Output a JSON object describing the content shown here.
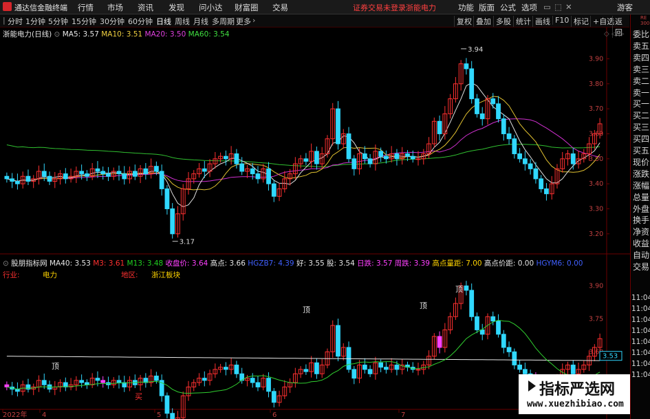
{
  "app": {
    "title": "通达信金融终端"
  },
  "menu": [
    "行情",
    "市场",
    "资讯",
    "发现",
    "问小达",
    "财富圈",
    "交易"
  ],
  "status": {
    "warning": "证券交易未登录",
    "stock_name": "浙能电力"
  },
  "right_menu": [
    "功能",
    "版面",
    "公式",
    "选项"
  ],
  "guest": "游客",
  "periods": [
    "分时",
    "1分钟",
    "5分钟",
    "15分钟",
    "30分钟",
    "60分钟",
    "日线",
    "周线",
    "月线",
    "多周期",
    "更多"
  ],
  "active_period": "日线",
  "toolbar": [
    "复权",
    "叠加",
    "多股",
    "统计",
    "画线",
    "F10",
    "标记",
    "+自选",
    "返回"
  ],
  "side_panel": {
    "top_small": "RE\n300",
    "items": [
      "委比",
      "卖五",
      "卖四",
      "卖三",
      "卖二",
      "卖一",
      "买一",
      "买二",
      "买三",
      "买四",
      "买五",
      "现价",
      "涨跌",
      "涨幅",
      "总量",
      "外盘",
      "换手",
      "净资",
      "收益",
      "自动",
      "交易"
    ],
    "times": [
      "11:04",
      "11:04",
      "11:04",
      "11:04",
      "11:04",
      "11:04",
      "11:04",
      "11:04"
    ]
  },
  "main_chart": {
    "title": "浙能电力(日线)",
    "ma5": "MA5: 3.57",
    "ma10": "MA10: 3.51",
    "ma20": "MA20: 3.50",
    "ma60": "MA60: 3.54",
    "high_label": "3.94",
    "low_label": "3.17",
    "yticks": [
      "3.90",
      "3.80",
      "3.70",
      "3.60",
      "3.50",
      "3.40",
      "3.30",
      "3.20"
    ],
    "ylim": [
      3.15,
      3.97
    ]
  },
  "sub_chart": {
    "title": "股朋指标网",
    "items": [
      {
        "t": "MA40: 3.53",
        "c": "wht"
      },
      {
        "t": "M3: 3.61",
        "c": "red"
      },
      {
        "t": "M13: 3.48",
        "c": "green"
      },
      {
        "t": "收盘价: 3.64",
        "c": "mag"
      },
      {
        "t": "高点: 3.66",
        "c": "wht"
      },
      {
        "t": "HGZB7: 4.39",
        "c": "blue"
      },
      {
        "t": "好: 3.55",
        "c": "wht"
      },
      {
        "t": "股: 3.54",
        "c": "wht"
      },
      {
        "t": "日跌: 3.57",
        "c": "mag"
      },
      {
        "t": "周跌: 3.39",
        "c": "mag"
      },
      {
        "t": "高点量距: 7.00",
        "c": "yel"
      },
      {
        "t": "高点价距: 0.00",
        "c": "wht"
      },
      {
        "t": "HGYM6: 0.00",
        "c": "blue"
      }
    ],
    "industry_label": "行业:",
    "industry_value": "电力",
    "region_label": "地区:",
    "region_value": "浙江板块",
    "yticks": [
      "3.90",
      "3.75",
      "3.60",
      "3.45"
    ],
    "current_price_box": "3.53",
    "marks": {
      "top": "顶",
      "buy": "买"
    }
  },
  "x_axis": [
    "2022年",
    "4",
    "5",
    "6",
    "7"
  ],
  "chart_data": {
    "type": "candlestick",
    "title": "浙能电力(日线)",
    "ylim": [
      3.15,
      3.97
    ],
    "high": 3.94,
    "low": 3.17,
    "close_series": [
      3.42,
      3.41,
      3.4,
      3.43,
      3.41,
      3.42,
      3.45,
      3.43,
      3.41,
      3.42,
      3.44,
      3.42,
      3.43,
      3.45,
      3.44,
      3.43,
      3.46,
      3.45,
      3.44,
      3.43,
      3.45,
      3.44,
      3.42,
      3.45,
      3.43,
      3.46,
      3.44,
      3.47,
      3.45,
      3.38,
      3.3,
      3.2,
      3.28,
      3.38,
      3.42,
      3.44,
      3.46,
      3.45,
      3.48,
      3.5,
      3.51,
      3.5,
      3.52,
      3.48,
      3.45,
      3.46,
      3.44,
      3.42,
      3.46,
      3.4,
      3.35,
      3.38,
      3.42,
      3.44,
      3.48,
      3.5,
      3.49,
      3.53,
      3.48,
      3.52,
      3.58,
      3.7,
      3.56,
      3.6,
      3.5,
      3.46,
      3.52,
      3.5,
      3.48,
      3.53,
      3.51,
      3.5,
      3.52,
      3.5,
      3.52,
      3.51,
      3.5,
      3.5,
      3.52,
      3.56,
      3.65,
      3.6,
      3.68,
      3.74,
      3.8,
      3.88,
      3.86,
      3.74,
      3.68,
      3.66,
      3.74,
      3.72,
      3.66,
      3.6,
      3.58,
      3.52,
      3.5,
      3.48,
      3.46,
      3.42,
      3.38,
      3.36,
      3.4,
      3.46,
      3.5,
      3.52,
      3.48,
      3.5,
      3.52,
      3.56,
      3.6,
      3.64
    ],
    "ma5": 3.57,
    "ma10": 3.51,
    "ma20": 3.5,
    "ma60": 3.54
  }
}
